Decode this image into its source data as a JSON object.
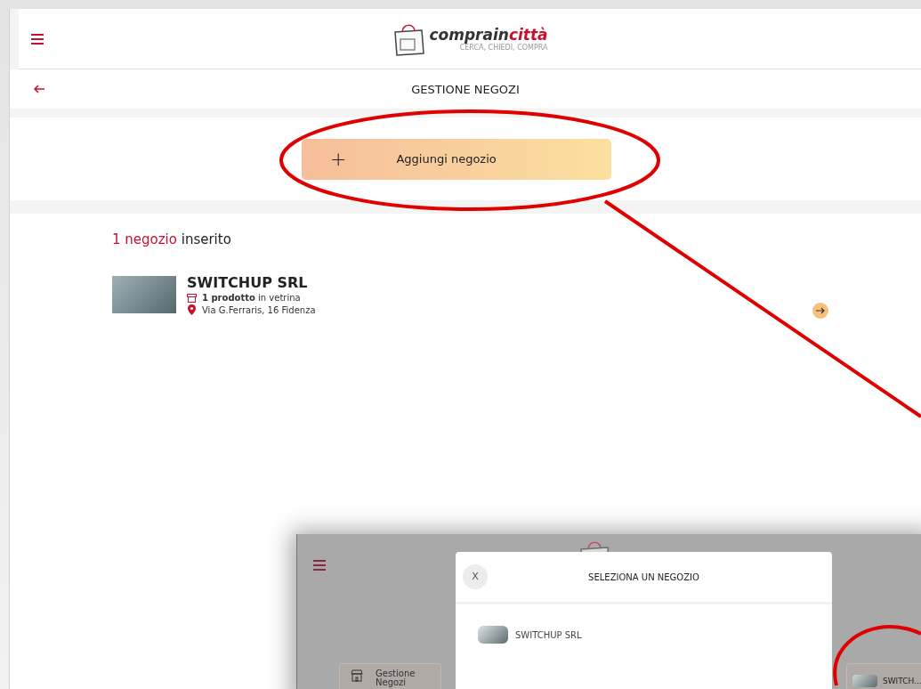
{
  "header": {
    "logo": {
      "brand_start": "comprain",
      "brand_end": "città",
      "tagline": "CERCA, CHIEDI, COMPRA"
    },
    "title": "GESTIONE NEGOZI"
  },
  "add_button": {
    "icon": "+",
    "label": "Aggiungi negozio"
  },
  "summary": {
    "count": "1 negozio",
    "rest": "inserito"
  },
  "shops": [
    {
      "name": "SWITCHUP SRL",
      "products": "**1 prodotto** in vetrina",
      "address": "Via G.Ferraris, 16 Fidenza"
    }
  ],
  "inset": {
    "dialog": {
      "close": "X",
      "title": "SELEZIONA UN NEGOZIO",
      "items": [
        {
          "name": "SWITCHUP SRL"
        }
      ]
    },
    "menu_card": "Gestione Negozi",
    "shop_chip": "SWITCH..."
  }
}
